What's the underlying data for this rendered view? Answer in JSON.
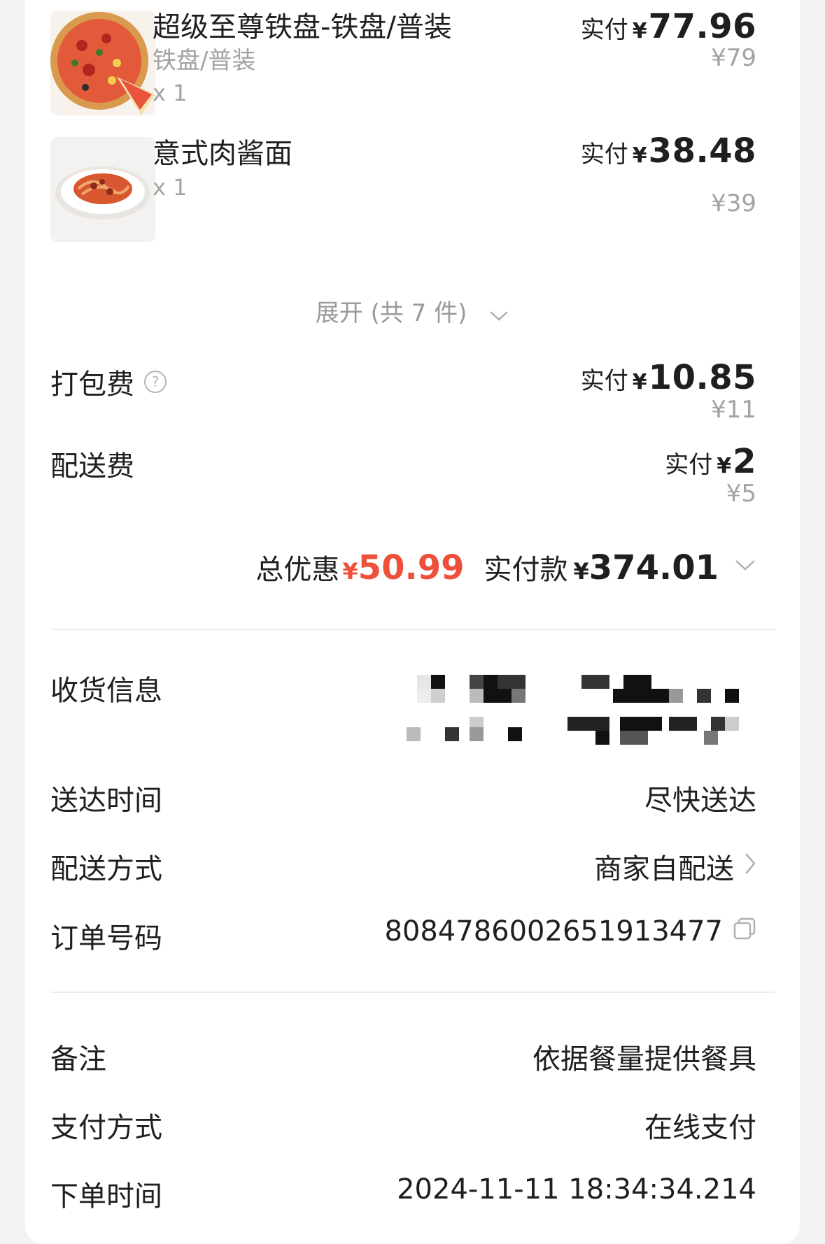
{
  "products": [
    {
      "name": "超级至尊铁盘-铁盘/普装",
      "spec": "铁盘/普装",
      "qty": "x 1",
      "paid_label": "实付",
      "currency": "¥",
      "paid_amount": "77.96",
      "original_price": "¥79",
      "image": "pizza-image"
    },
    {
      "name": "意式肉酱面",
      "spec": "",
      "qty": "x 1",
      "paid_label": "实付",
      "currency": "¥",
      "paid_amount": "38.48",
      "original_price": "¥39",
      "image": "pasta-image"
    }
  ],
  "expand": {
    "label": "展开 (共 7 件)"
  },
  "fees": [
    {
      "label": "打包费",
      "paid_label": "实付",
      "currency": "¥",
      "paid_amount": "10.85",
      "original_price": "¥11",
      "has_help_icon": true
    },
    {
      "label": "配送费",
      "paid_label": "实付",
      "currency": "¥",
      "paid_amount": "2",
      "original_price": "¥5",
      "has_help_icon": false
    }
  ],
  "summary": {
    "discount_label": "总优惠",
    "discount_currency": "¥",
    "discount_amount": "50.99",
    "total_label": "实付款",
    "total_currency": "¥",
    "total_amount": "374.01"
  },
  "info": {
    "receiver": {
      "label": "收货信息"
    },
    "delivery_time": {
      "label": "送达时间",
      "value": "尽快送达"
    },
    "delivery_method": {
      "label": "配送方式",
      "value": "商家自配送"
    },
    "order_no": {
      "label": "订单号码",
      "value": "8084786002651913477"
    },
    "remark": {
      "label": "备注",
      "value": "依据餐量提供餐具"
    },
    "payment": {
      "label": "支付方式",
      "value": "在线支付"
    },
    "order_time": {
      "label": "下单时间",
      "value": "2024-11-11 18:34:34.214"
    }
  },
  "colors": {
    "discount": "#f0503a",
    "muted_text": "#a3a3a3",
    "primary_text": "#1f1f1f",
    "divider": "#ececec"
  },
  "icons": [
    "help-icon",
    "chevron-down-icon",
    "chevron-right-icon",
    "copy-icon"
  ]
}
